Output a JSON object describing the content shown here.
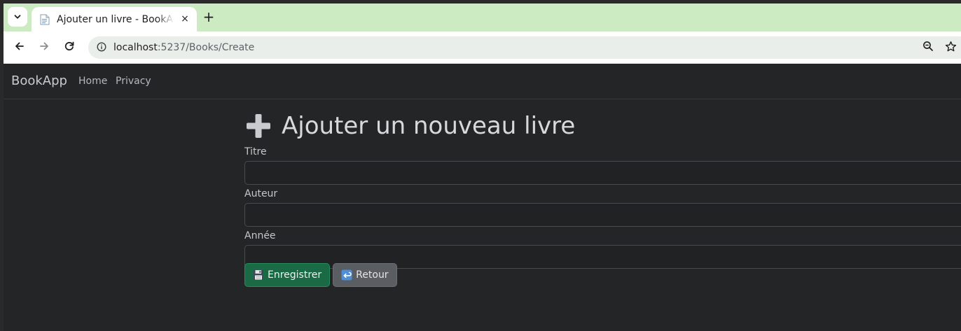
{
  "browser": {
    "tab_title": "Ajouter un livre - BookApp",
    "tab_close": "×",
    "new_tab": "+",
    "url_host": "localhost",
    "url_path": ":5237/Books/Create",
    "icons": {
      "tab_menu": "chevron-down-icon",
      "favicon": "document-icon",
      "back": "arrow-left-icon",
      "forward": "arrow-right-icon",
      "reload": "reload-icon",
      "site_info": "info-icon",
      "zoom": "zoom-out-icon",
      "bookmark": "star-icon"
    },
    "colors": {
      "tabstrip": "#cdebc3",
      "toolbar": "#ffffff",
      "omnibox": "#e9eeea"
    }
  },
  "navbar": {
    "brand": "BookApp",
    "links": [
      "Home",
      "Privacy"
    ]
  },
  "form": {
    "heading": "Ajouter un nouveau livre",
    "heading_icon": "plus-icon",
    "fields": [
      {
        "label": "Titre",
        "value": ""
      },
      {
        "label": "Auteur",
        "value": ""
      },
      {
        "label": "Année",
        "value": ""
      }
    ],
    "buttons": {
      "save_label": "Enregistrer",
      "save_icon": "floppy-disk-icon",
      "back_label": "Retour",
      "back_icon": "return-arrow-icon"
    }
  },
  "theme": {
    "page_background": "#242527",
    "success": "#1a6a45",
    "secondary": "#5a5d62"
  }
}
